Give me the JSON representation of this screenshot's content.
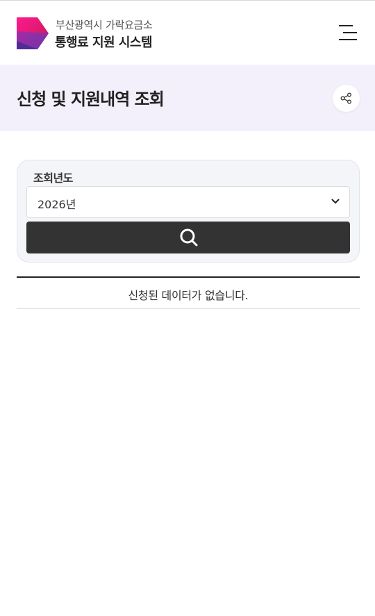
{
  "header": {
    "brand_sub": "부산광역시 가락요금소",
    "brand_main": "통행료 지원 시스템",
    "logo_colors": [
      "#e4007f",
      "#c2185b",
      "#6a3fb5"
    ]
  },
  "title_band": {
    "title": "신청 및 지원내역 조회",
    "background": "#f3f0fb"
  },
  "search": {
    "label": "조회년도",
    "selected_year": "2026년",
    "button_icon": "search-icon",
    "button_color": "#333333"
  },
  "result": {
    "empty_message": "신청된 데이터가 없습니다."
  },
  "icons": {
    "menu": "hamburger-menu-icon",
    "share": "share-icon",
    "dropdown": "chevron-down-icon"
  }
}
